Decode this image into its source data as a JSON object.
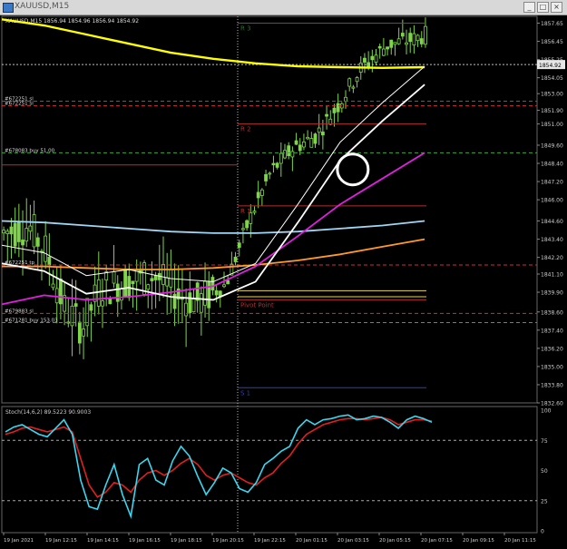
{
  "window": {
    "title": "XAUUSD,M15",
    "buttons": [
      "_",
      "□",
      "×"
    ]
  },
  "chart_data": {
    "type": "line",
    "header": "XAUUSD,M15  1856.94 1854.96 1856.94 1854.92",
    "symbol": "XAUUSD,M15",
    "price_axis": {
      "min": 1832.6,
      "max": 1858.1,
      "ticks": [
        "1857.65",
        "1856.45",
        "1855.25",
        "1854.05",
        "1853.00",
        "1851.90",
        "1851.00",
        "1849.60",
        "1848.40",
        "1847.20",
        "1846.00",
        "1844.60",
        "1843.40",
        "1842.20",
        "1841.10",
        "1839.90",
        "1838.60",
        "1837.40",
        "1836.20",
        "1835.00",
        "1833.80",
        "1832.60"
      ],
      "current_price": "1854.92"
    },
    "time_axis": {
      "labels": [
        "19 Jan 2021",
        "19 Jan 12:15",
        "19 Jan 14:15",
        "19 Jan 16:15",
        "19 Jan 18:15",
        "19 Jan 20:15",
        "19 Jan 22:15",
        "20 Jan 01:15",
        "20 Jan 03:15",
        "20 Jan 05:15",
        "20 Jan 07:15",
        "20 Jan 09:15",
        "20 Jan 11:15"
      ]
    },
    "pivots": [
      {
        "label": "R 3",
        "price": 1857.65,
        "color": "#2e6e2e"
      },
      {
        "label": "R 2",
        "price": 1851.0,
        "color": "#b03030"
      },
      {
        "label": "R 1",
        "price": 1845.6,
        "color": "#b03030"
      },
      {
        "label": "Pivot Point",
        "price": 1839.4,
        "color": "#b03030"
      },
      {
        "label": "S 1",
        "price": 1833.6,
        "color": "#3040b0"
      }
    ],
    "order_labels": [
      {
        "text": "#672251 sl",
        "price": 1852.5
      },
      {
        "text": "#672251 sl",
        "price": 1852.2
      },
      {
        "text": "#678083 buy 51.00",
        "price": 1849.1
      },
      {
        "text": "#672251 tp",
        "price": 1841.7
      },
      {
        "text": "#679883 sl",
        "price": 1838.5
      },
      {
        "text": "#671281 buy 153.03",
        "price": 1837.9
      }
    ],
    "series": [
      {
        "name": "",
        "color": "#ffff00",
        "x": [
          0,
          0.1,
          0.2,
          0.3,
          0.4,
          0.5,
          0.6,
          0.7,
          0.8,
          0.9,
          1.0
        ],
        "values": [
          1857.9,
          1857.5,
          1856.9,
          1856.3,
          1855.7,
          1855.3,
          1855.0,
          1854.8,
          1854.75,
          1854.7,
          1854.75
        ]
      },
      {
        "name": "",
        "color": "#9fd6f5",
        "x": [
          0,
          0.1,
          0.2,
          0.3,
          0.4,
          0.5,
          0.6,
          0.7,
          0.8,
          0.9,
          1.0
        ],
        "values": [
          1844.6,
          1844.5,
          1844.3,
          1844.1,
          1843.9,
          1843.8,
          1843.8,
          1843.9,
          1844.1,
          1844.3,
          1844.6
        ]
      },
      {
        "name": "",
        "color": "#ff9a2a",
        "x": [
          0,
          0.1,
          0.2,
          0.3,
          0.4,
          0.5,
          0.6,
          0.7,
          0.8,
          0.9,
          1.0
        ],
        "values": [
          1841.6,
          1841.6,
          1841.5,
          1841.4,
          1841.4,
          1841.5,
          1841.7,
          1842.0,
          1842.4,
          1842.9,
          1843.4
        ]
      },
      {
        "name": "",
        "color": "#e020e0",
        "x": [
          0,
          0.1,
          0.2,
          0.3,
          0.4,
          0.5,
          0.6,
          0.7,
          0.8,
          0.9,
          1.0
        ],
        "values": [
          1839.1,
          1839.7,
          1839.4,
          1839.6,
          1839.9,
          1840.3,
          1841.6,
          1843.6,
          1845.7,
          1847.4,
          1849.1
        ]
      },
      {
        "name": "",
        "color": "#ffffff",
        "x": [
          0,
          0.1,
          0.2,
          0.3,
          0.4,
          0.5,
          0.6,
          0.7,
          0.8,
          0.9,
          1.0
        ],
        "values": [
          1841.8,
          1841.3,
          1839.8,
          1840.2,
          1839.6,
          1839.4,
          1840.6,
          1844.5,
          1848.6,
          1851.2,
          1853.6
        ]
      }
    ],
    "markers": [
      {
        "type": "circle",
        "x": 0.83,
        "price": 1848.0
      }
    ],
    "stochastic": {
      "label": "Stoch(14,6,2) 89.5223 90.9003",
      "ticks": [
        "100",
        "75",
        "50",
        "25",
        "0"
      ],
      "levels": [
        75,
        25
      ],
      "main": {
        "color": "#3ad7f0",
        "values": [
          82,
          86,
          88,
          84,
          80,
          78,
          85,
          92,
          80,
          42,
          20,
          18,
          38,
          55,
          30,
          12,
          55,
          60,
          42,
          38,
          58,
          70,
          62,
          45,
          30,
          40,
          52,
          48,
          35,
          32,
          40,
          55,
          60,
          66,
          70,
          85,
          92,
          88,
          92,
          93,
          95,
          96,
          92,
          93,
          95,
          94,
          90,
          85,
          92,
          95,
          93,
          90
        ]
      },
      "signal": {
        "color": "#e02020",
        "values": [
          80,
          82,
          85,
          86,
          84,
          82,
          84,
          86,
          82,
          60,
          38,
          28,
          32,
          40,
          38,
          32,
          42,
          48,
          50,
          46,
          50,
          56,
          60,
          55,
          46,
          42,
          46,
          48,
          44,
          40,
          38,
          44,
          48,
          56,
          62,
          72,
          80,
          84,
          88,
          90,
          92,
          93,
          93,
          92,
          93,
          94,
          92,
          88,
          90,
          92,
          92,
          91
        ]
      }
    }
  }
}
